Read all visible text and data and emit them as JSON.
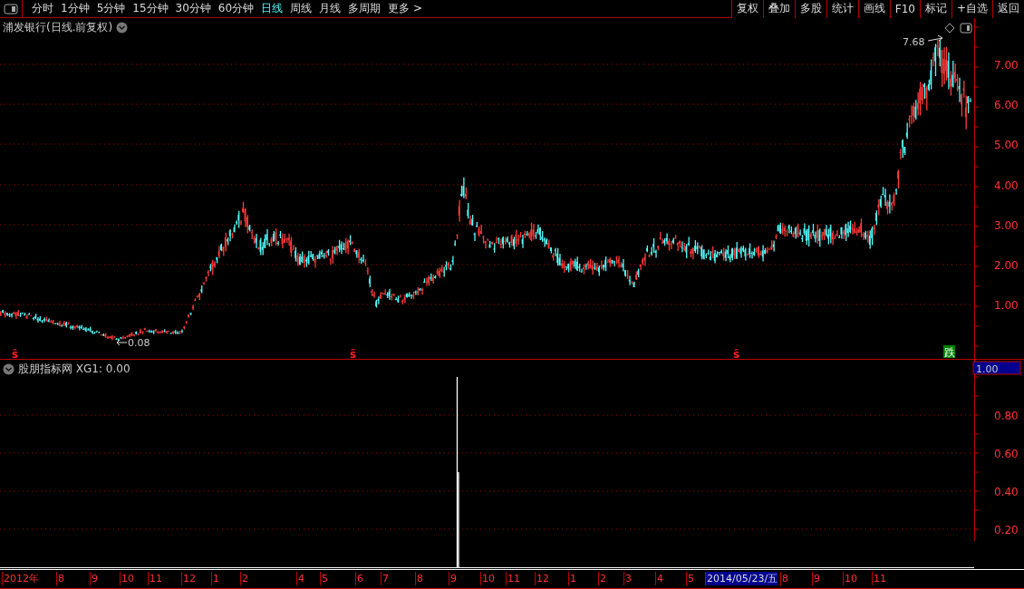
{
  "toolbar": {
    "periods": [
      {
        "label": "分时",
        "selected": false
      },
      {
        "label": "1分钟",
        "selected": false
      },
      {
        "label": "5分钟",
        "selected": false
      },
      {
        "label": "15分钟",
        "selected": false
      },
      {
        "label": "30分钟",
        "selected": false
      },
      {
        "label": "60分钟",
        "selected": false
      },
      {
        "label": "日线",
        "selected": true
      },
      {
        "label": "周线",
        "selected": false
      },
      {
        "label": "月线",
        "selected": false
      },
      {
        "label": "多周期",
        "selected": false
      },
      {
        "label": "更多 >",
        "selected": false
      }
    ],
    "buttons": [
      "复权",
      "叠加",
      "多股",
      "统计",
      "画线",
      "F10",
      "标记",
      "+自选",
      "返回"
    ]
  },
  "main_chart": {
    "title": "浦发银行(日线.前复权)",
    "price_labels": [
      "7.00",
      "6.00",
      "5.00",
      "4.00",
      "3.00",
      "2.00",
      "1.00"
    ],
    "high_annotation": "7.68",
    "low_annotation": "0.08",
    "markers": [
      {
        "kind": "buy",
        "text": "ŝ"
      },
      {
        "kind": "buy",
        "text": "ŝ"
      },
      {
        "kind": "buy",
        "text": "ŝ"
      },
      {
        "kind": "fall",
        "text": "跌"
      }
    ]
  },
  "indicator": {
    "label": "股朋指标网 XG1: 0.00",
    "current_value": "1.00",
    "value_labels": [
      "0.80",
      "0.60",
      "0.40",
      "0.20"
    ]
  },
  "date_axis": [
    {
      "label": "2012年",
      "selected": false
    },
    {
      "label": "8",
      "selected": false
    },
    {
      "label": "9",
      "selected": false
    },
    {
      "label": "10",
      "selected": false
    },
    {
      "label": "11",
      "selected": false
    },
    {
      "label": "12",
      "selected": false
    },
    {
      "label": "1",
      "selected": false
    },
    {
      "label": "2",
      "selected": false
    },
    {
      "label": "4",
      "selected": false
    },
    {
      "label": "5",
      "selected": false
    },
    {
      "label": "6",
      "selected": false
    },
    {
      "label": "7",
      "selected": false
    },
    {
      "label": "8",
      "selected": false
    },
    {
      "label": "9",
      "selected": false
    },
    {
      "label": "10",
      "selected": false
    },
    {
      "label": "11",
      "selected": false
    },
    {
      "label": "12",
      "selected": false
    },
    {
      "label": "1",
      "selected": false
    },
    {
      "label": "2",
      "selected": false
    },
    {
      "label": "3",
      "selected": false
    },
    {
      "label": "4",
      "selected": false
    },
    {
      "label": "5",
      "selected": false
    },
    {
      "label": "2014/05/23/五",
      "selected": true
    },
    {
      "label": "8",
      "selected": false
    },
    {
      "label": "9",
      "selected": false
    },
    {
      "label": "10",
      "selected": false
    },
    {
      "label": "11",
      "selected": false
    }
  ]
}
